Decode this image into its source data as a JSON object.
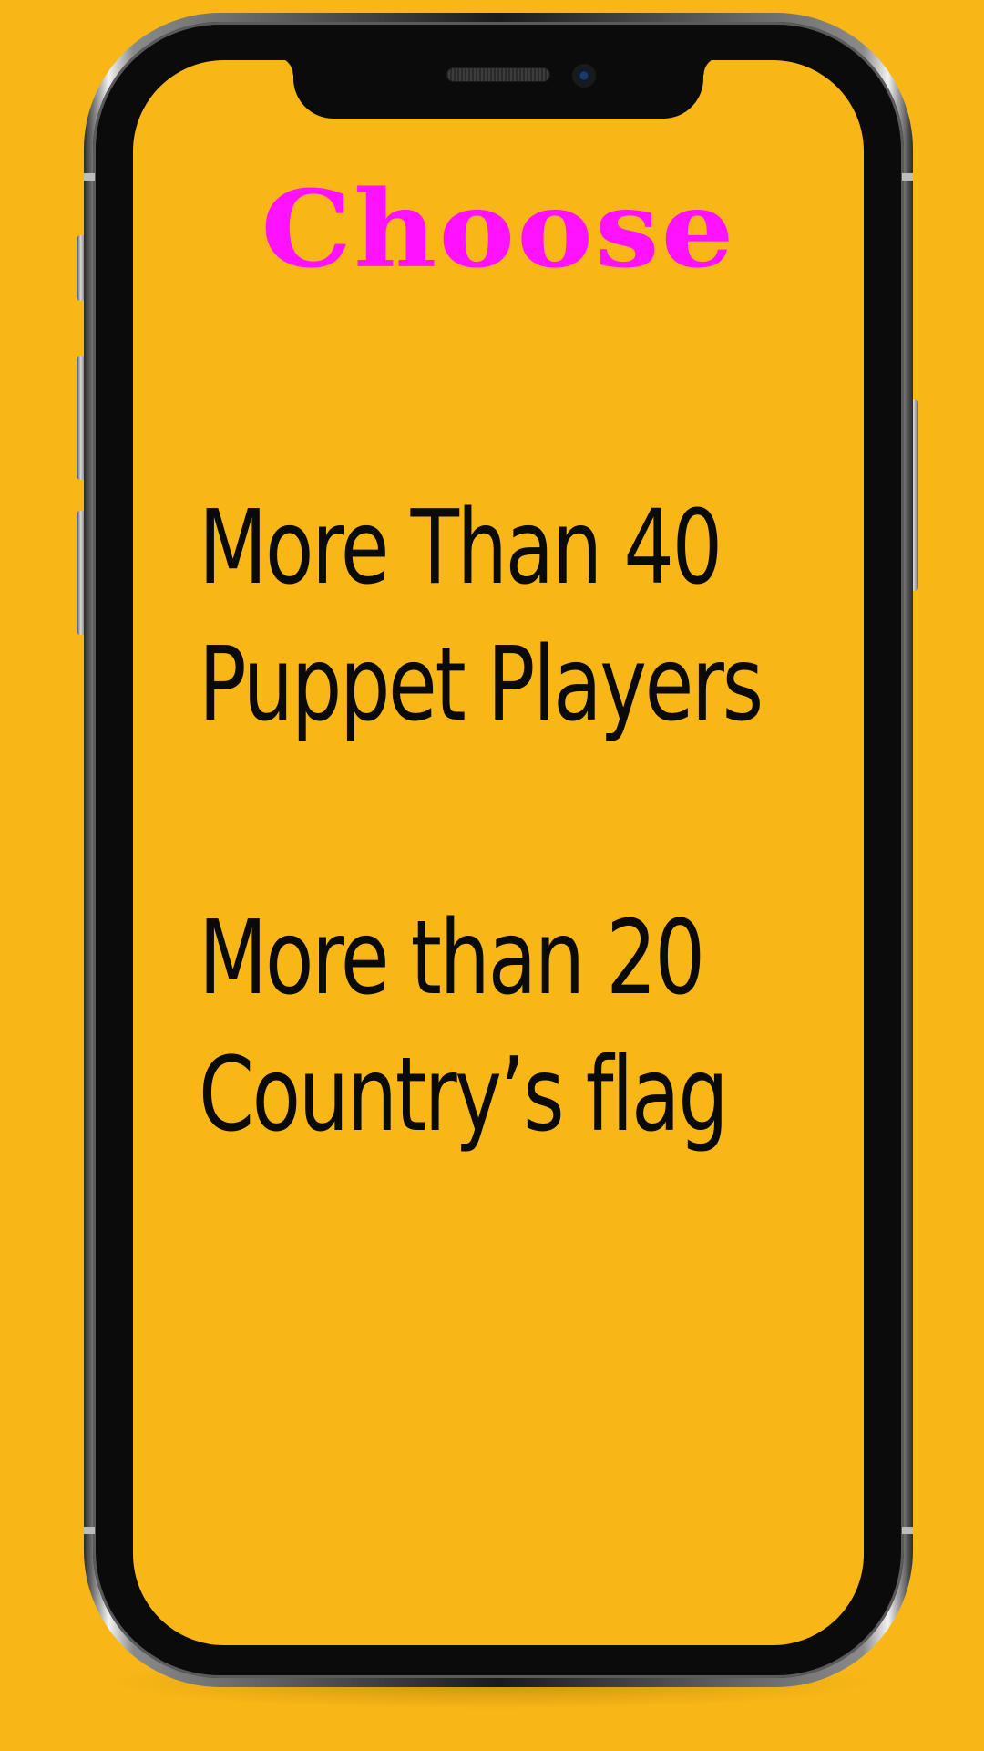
{
  "screen": {
    "title": "Choose",
    "features": [
      {
        "line1": "More Than 40",
        "line2": "Puppet Players"
      },
      {
        "line1": "More than 20",
        "line2": "Country’s flag"
      }
    ]
  },
  "colors": {
    "background": "#f9b717",
    "title": "#ff12ff",
    "text": "#0a0a0a"
  }
}
